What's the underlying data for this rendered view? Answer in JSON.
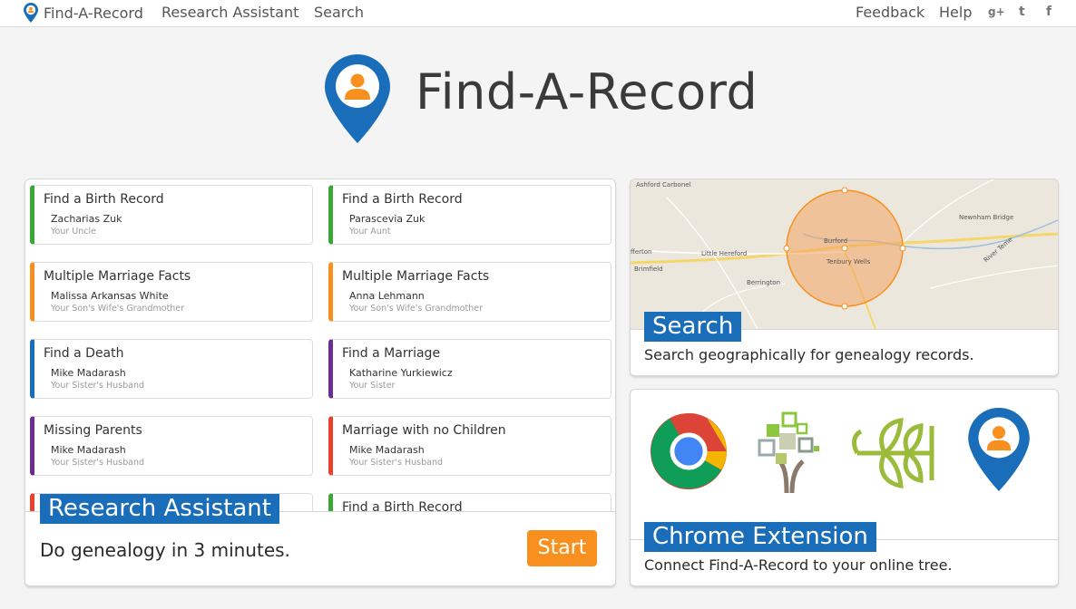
{
  "nav": {
    "brand": "Find-A-Record",
    "links": [
      "Research Assistant",
      "Search"
    ],
    "right_links": [
      "Feedback",
      "Help"
    ],
    "social": [
      {
        "glyph": "g+",
        "icon": "google-plus-icon"
      },
      {
        "glyph": "t",
        "icon": "twitter-icon"
      },
      {
        "glyph": "f",
        "icon": "facebook-icon"
      }
    ]
  },
  "hero": {
    "title": "Find-A-Record"
  },
  "research_assistant": {
    "label": "Research Assistant",
    "tagline": "Do genealogy in 3 minutes.",
    "start_label": "Start",
    "cards": [
      {
        "title": "Find a Birth Record",
        "name": "Zacharias Zuk",
        "relation": "Your Uncle",
        "color": "#3aa835"
      },
      {
        "title": "Find a Birth Record",
        "name": "Parascevia Zuk",
        "relation": "Your Aunt",
        "color": "#3aa835"
      },
      {
        "title": "Multiple Marriage Facts",
        "name": "Malissa Arkansas White",
        "relation": "Your Son's Wife's Grandmother",
        "color": "#f7901e"
      },
      {
        "title": "Multiple Marriage Facts",
        "name": "Anna Lehmann",
        "relation": "Your Son's Wife's Grandmother",
        "color": "#f7901e"
      },
      {
        "title": "Find a Death",
        "name": "Mike Madarash",
        "relation": "Your Sister's Husband",
        "color": "#1a6db8"
      },
      {
        "title": "Find a Marriage",
        "name": "Katharine Yurkiewicz",
        "relation": "Your Sister",
        "color": "#6b2d8e"
      },
      {
        "title": "Missing Parents",
        "name": "Mike Madarash",
        "relation": "Your Sister's Husband",
        "color": "#6b2d8e"
      },
      {
        "title": "Marriage with no Children",
        "name": "Mike Madarash",
        "relation": "Your Sister's Husband",
        "color": "#e8412c"
      },
      {
        "title": "",
        "name": "",
        "relation": "",
        "color": "#e8412c"
      },
      {
        "title": "Find a Birth Record",
        "name": "",
        "relation": "",
        "color": "#3aa835"
      }
    ]
  },
  "search": {
    "label": "Search",
    "description": "Search geographically for genealogy records.",
    "map_labels": [
      "Ashford Carbonel",
      "Newnham Bridge",
      "River Teme",
      "Little Hereford",
      "Burford",
      "Tenbury Wells",
      "Brimfield",
      "Berrington",
      "fferton"
    ]
  },
  "extension": {
    "label": "Chrome Extension",
    "description": "Connect Find-A-Record to your online tree.",
    "icons": [
      "chrome-icon",
      "familysearch-tree-icon",
      "ancestry-leaf-icon",
      "find-a-record-pin-icon"
    ]
  },
  "colors": {
    "brand_blue": "#1a6db8",
    "accent_orange": "#f7901e"
  }
}
